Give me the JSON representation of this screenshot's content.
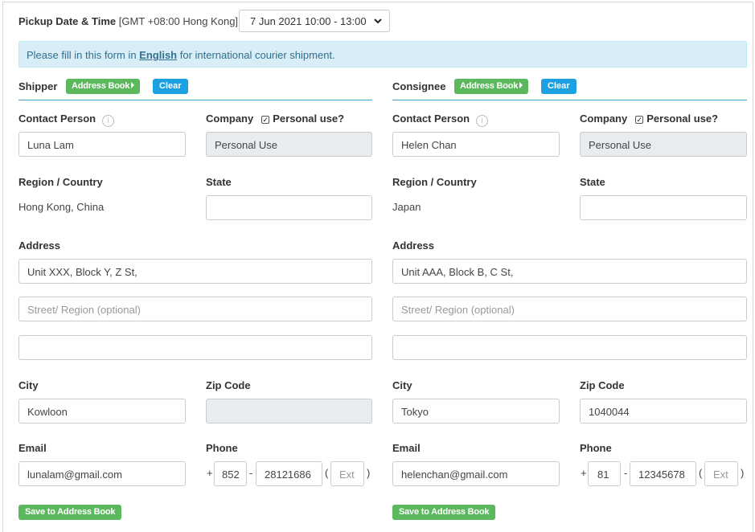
{
  "pickup": {
    "label": "Pickup Date & Time",
    "timezone": "[GMT +08:00 Hong Kong]",
    "selected": "7 Jun 2021 10:00 - 13:00"
  },
  "notice": {
    "prefix": "Please fill in this form in ",
    "emphasis": "English",
    "suffix": " for international courier shipment."
  },
  "labels": {
    "contact_person": "Contact Person",
    "company": "Company",
    "personal_use": "Personal use?",
    "region_country": "Region / Country",
    "state": "State",
    "address": "Address",
    "city": "City",
    "zip_code": "Zip Code",
    "email": "Email",
    "phone": "Phone",
    "address_book": "Address Book",
    "clear": "Clear",
    "save_to_address_book": "Save to Address Book",
    "street_placeholder": "Street/ Region (optional)",
    "ext_placeholder": "Ext",
    "plus": "+",
    "dash": "-",
    "paren_open": "(",
    "paren_close": ")"
  },
  "shipper": {
    "title": "Shipper",
    "contact_person": "Luna Lam",
    "company": "Personal Use",
    "personal_use_checked": true,
    "region_country": "Hong Kong, China",
    "state": "",
    "address1": "Unit XXX, Block Y, Z St,",
    "address2": "",
    "address3": "",
    "city": "Kowloon",
    "zip_code": "",
    "email": "lunalam@gmail.com",
    "phone_country_code": "852",
    "phone_number": "28121686",
    "phone_ext": ""
  },
  "consignee": {
    "title": "Consignee",
    "contact_person": "Helen Chan",
    "company": "Personal Use",
    "personal_use_checked": true,
    "region_country": "Japan",
    "state": "",
    "address1": "Unit AAA, Block B, C St,",
    "address2": "",
    "address3": "",
    "city": "Tokyo",
    "zip_code": "1040044",
    "email": "helenchan@gmail.com",
    "phone_country_code": "81",
    "phone_number": "12345678",
    "phone_ext": ""
  },
  "colors": {
    "green": "#5cb85c",
    "blue": "#1ba1e2",
    "notice_bg": "#d9edf7",
    "rule": "#3c9cc8"
  }
}
